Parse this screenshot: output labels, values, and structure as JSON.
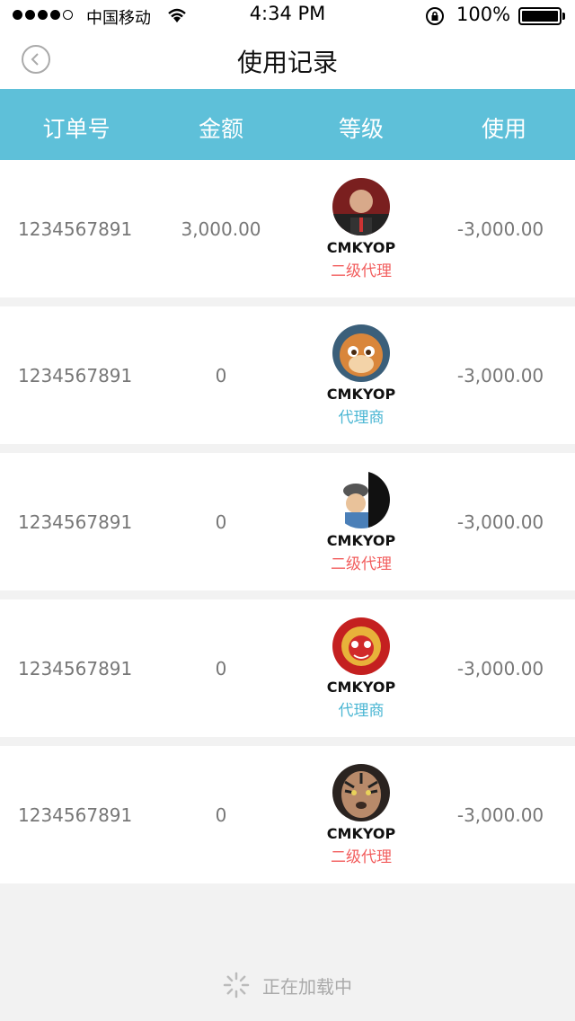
{
  "status": {
    "carrier": "中国移动",
    "time": "4:34 PM",
    "battery": "100%"
  },
  "nav": {
    "title": "使用记录"
  },
  "table": {
    "headers": [
      "订单号",
      "金额",
      "等级",
      "使用"
    ],
    "rows": [
      {
        "order": "1234567891",
        "amount": "3,000.00",
        "name": "CMKYOP",
        "level": "二级代理",
        "level_color": "#f25d5d",
        "use": "-3,000.00",
        "avatar": "man-avatar"
      },
      {
        "order": "1234567891",
        "amount": "0",
        "name": "CMKYOP",
        "level": "代理商",
        "level_color": "#4ab6d3",
        "use": "-3,000.00",
        "avatar": "chipmunk-avatar"
      },
      {
        "order": "1234567891",
        "amount": "0",
        "name": "CMKYOP",
        "level": "二级代理",
        "level_color": "#f25d5d",
        "use": "-3,000.00",
        "avatar": "cartoon-grandpa-avatar"
      },
      {
        "order": "1234567891",
        "amount": "0",
        "name": "CMKYOP",
        "level": "代理商",
        "level_color": "#4ab6d3",
        "use": "-3,000.00",
        "avatar": "opera-mask-avatar"
      },
      {
        "order": "1234567891",
        "amount": "0",
        "name": "CMKYOP",
        "level": "二级代理",
        "level_color": "#f25d5d",
        "use": "-3,000.00",
        "avatar": "tiger-avatar"
      }
    ]
  },
  "footer": {
    "loading_text": "正在加载中"
  },
  "colors": {
    "header_bg": "#5ec0d9",
    "red_tag": "#f25d5d",
    "blue_tag": "#4ab6d3"
  }
}
